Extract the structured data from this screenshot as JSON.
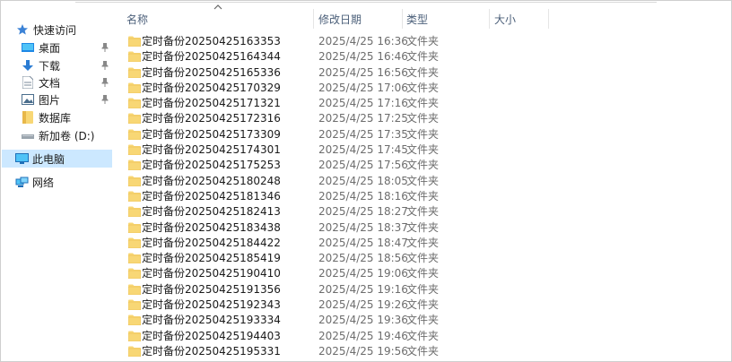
{
  "nav": {
    "quick_access": "快速访问",
    "desktop": "桌面",
    "downloads": "下载",
    "documents": "文档",
    "pictures": "图片",
    "database": "数据库",
    "new_volume": "新加卷 (D:)",
    "this_pc": "此电脑",
    "network": "网络"
  },
  "columns": {
    "name": "名称",
    "modified": "修改日期",
    "type": "类型",
    "size": "大小"
  },
  "colors": {
    "folder": "#f8d775",
    "folder_dark": "#e8b84a",
    "selected_bg": "#cce8ff",
    "header_text": "#4c607a",
    "star": "#3b82d6"
  },
  "files": [
    {
      "name": "定时备份20250425163353",
      "modified": "2025/4/25 16:36",
      "type": "文件夹"
    },
    {
      "name": "定时备份20250425164344",
      "modified": "2025/4/25 16:46",
      "type": "文件夹"
    },
    {
      "name": "定时备份20250425165336",
      "modified": "2025/4/25 16:56",
      "type": "文件夹"
    },
    {
      "name": "定时备份20250425170329",
      "modified": "2025/4/25 17:06",
      "type": "文件夹"
    },
    {
      "name": "定时备份20250425171321",
      "modified": "2025/4/25 17:16",
      "type": "文件夹"
    },
    {
      "name": "定时备份20250425172316",
      "modified": "2025/4/25 17:25",
      "type": "文件夹"
    },
    {
      "name": "定时备份20250425173309",
      "modified": "2025/4/25 17:35",
      "type": "文件夹"
    },
    {
      "name": "定时备份20250425174301",
      "modified": "2025/4/25 17:45",
      "type": "文件夹"
    },
    {
      "name": "定时备份20250425175253",
      "modified": "2025/4/25 17:56",
      "type": "文件夹"
    },
    {
      "name": "定时备份20250425180248",
      "modified": "2025/4/25 18:05",
      "type": "文件夹"
    },
    {
      "name": "定时备份20250425181346",
      "modified": "2025/4/25 18:16",
      "type": "文件夹"
    },
    {
      "name": "定时备份20250425182413",
      "modified": "2025/4/25 18:27",
      "type": "文件夹"
    },
    {
      "name": "定时备份20250425183438",
      "modified": "2025/4/25 18:37",
      "type": "文件夹"
    },
    {
      "name": "定时备份20250425184422",
      "modified": "2025/4/25 18:47",
      "type": "文件夹"
    },
    {
      "name": "定时备份20250425185419",
      "modified": "2025/4/25 18:56",
      "type": "文件夹"
    },
    {
      "name": "定时备份20250425190410",
      "modified": "2025/4/25 19:06",
      "type": "文件夹"
    },
    {
      "name": "定时备份20250425191356",
      "modified": "2025/4/25 19:16",
      "type": "文件夹"
    },
    {
      "name": "定时备份20250425192343",
      "modified": "2025/4/25 19:26",
      "type": "文件夹"
    },
    {
      "name": "定时备份20250425193334",
      "modified": "2025/4/25 19:36",
      "type": "文件夹"
    },
    {
      "name": "定时备份20250425194403",
      "modified": "2025/4/25 19:46",
      "type": "文件夹"
    },
    {
      "name": "定时备份20250425195331",
      "modified": "2025/4/25 19:56",
      "type": "文件夹"
    }
  ]
}
